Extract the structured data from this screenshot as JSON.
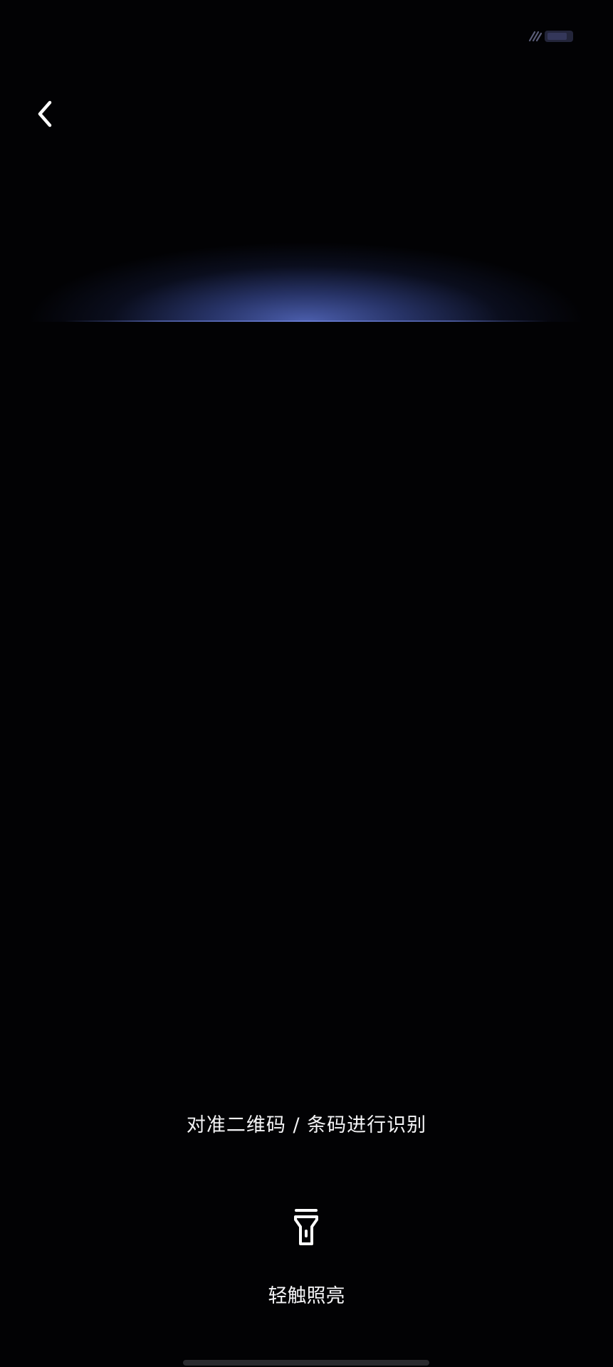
{
  "status_bar": {
    "signal_icon": "signal-icon",
    "battery_icon": "battery-icon",
    "battery_level": 0.85
  },
  "navigation": {
    "back_icon": "chevron-left-icon"
  },
  "scanner": {
    "scan_line_color": "#5f78dc",
    "hint": "对准二维码 / 条码进行识别"
  },
  "flashlight": {
    "icon": "flashlight-icon",
    "label": "轻触照亮"
  },
  "colors": {
    "background": "#020204",
    "text": "#f4f4f6"
  }
}
